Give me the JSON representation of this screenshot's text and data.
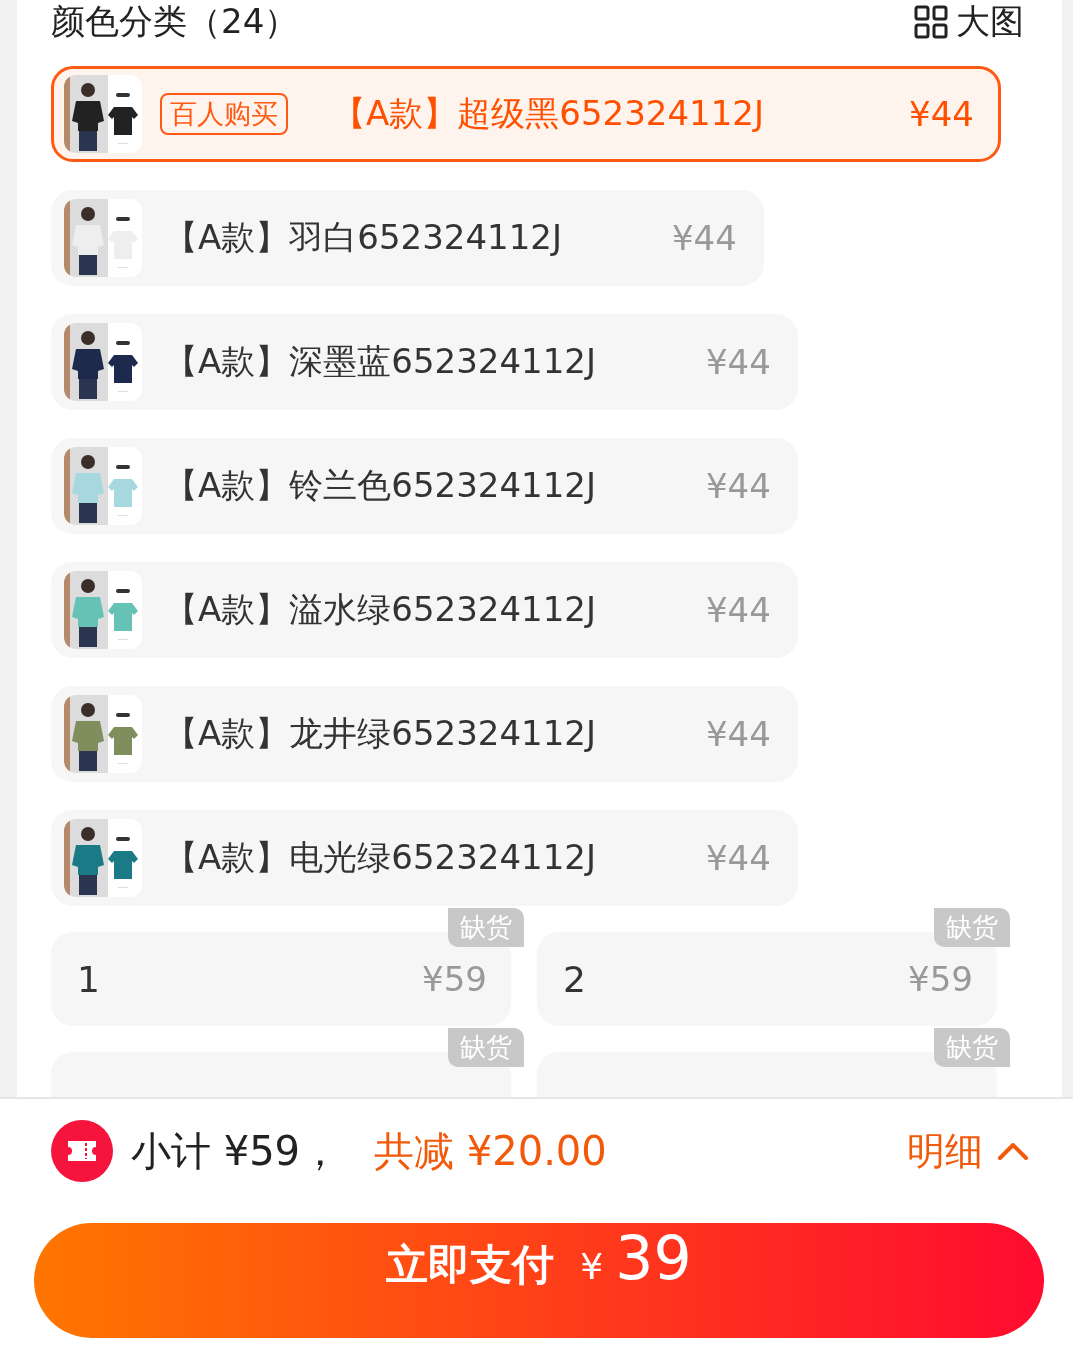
{
  "header": {
    "title": "颜色分类（24）",
    "view_toggle": "大图"
  },
  "colors": [
    {
      "badge": "百人购买",
      "name": "【A款】超级黑652324112J",
      "price": "¥44",
      "selected": true
    },
    {
      "name": "【A款】羽白652324112J",
      "price": "¥44",
      "selected": false
    },
    {
      "name": "【A款】深墨蓝652324112J",
      "price": "¥44",
      "selected": false
    },
    {
      "name": "【A款】铃兰色652324112J",
      "price": "¥44",
      "selected": false
    },
    {
      "name": "【A款】溢水绿652324112J",
      "price": "¥44",
      "selected": false
    },
    {
      "name": "【A款】龙井绿652324112J",
      "price": "¥44",
      "selected": false
    },
    {
      "name": "【A款】电光绿652324112J",
      "price": "¥44",
      "selected": false
    }
  ],
  "sizes": [
    {
      "label": "1",
      "price": "¥59",
      "badge": "缺货"
    },
    {
      "label": "2",
      "price": "¥59",
      "badge": "缺货"
    },
    {
      "badge": "缺货"
    },
    {
      "badge": "缺货"
    }
  ],
  "footer": {
    "subtotal": "小计 ¥59，",
    "discount": "共减 ¥20.00",
    "details": "明细",
    "pay_button": {
      "label": "立即支付",
      "currency": "¥",
      "amount": "39"
    }
  }
}
